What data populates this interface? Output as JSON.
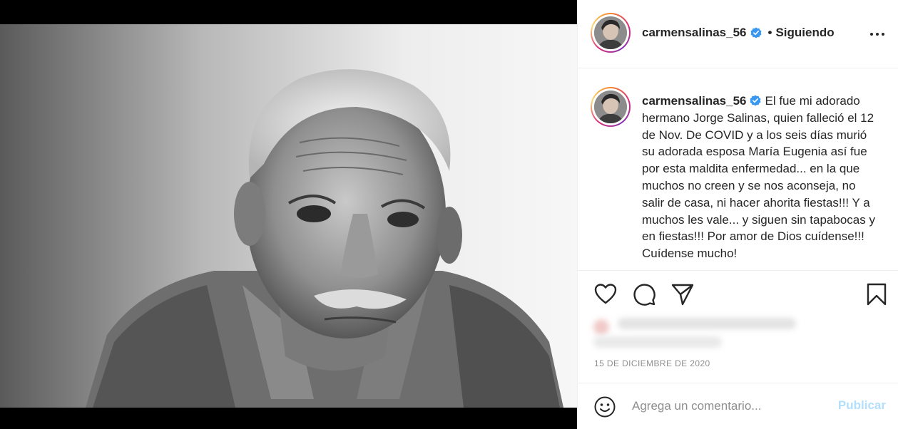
{
  "post": {
    "photo_description_icon": "portrait-photo",
    "username": "carmensalinas_56",
    "verified_icon": "verified-badge-icon",
    "follow_separator": "•",
    "follow_status": "Siguiendo",
    "more_icon": "more-options-icon",
    "caption": {
      "username": "carmensalinas_56",
      "text": "El fue mi adorado hermano Jorge Salinas, quien falleció el 12 de Nov. De COVID y a los seis días murió su adorada esposa María Eugenia así fue por esta maldita enfermedad... en la que muchos no creen y se nos aconseja, no salir de casa, ni hacer ahorita fiestas!!! Y a muchos les vale... y siguen sin tapabocas y en fiestas!!! Por amor de Dios cuídense!!! Cuídense mucho!"
    },
    "actions": {
      "like_icon": "heart-icon",
      "comment_icon": "comment-icon",
      "share_icon": "paper-plane-icon",
      "save_icon": "bookmark-icon"
    },
    "timestamp": "15 DE DICIEMBRE DE 2020",
    "comment_box": {
      "emoji_icon": "smiley-icon",
      "placeholder": "Agrega un comentario...",
      "publish_label": "Publicar"
    }
  },
  "colors": {
    "accent": "#0095f6",
    "publish_disabled": "#b2dffc",
    "text_primary": "#262626",
    "text_secondary": "#8e8e8e"
  }
}
